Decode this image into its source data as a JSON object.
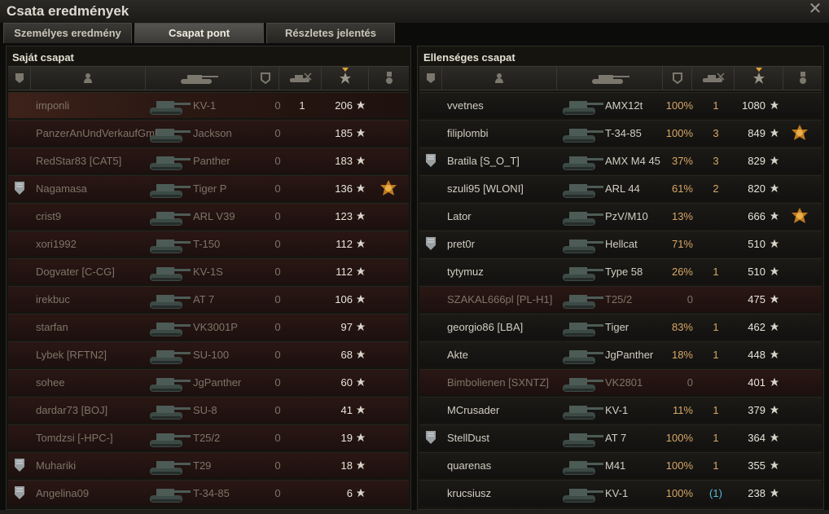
{
  "window": {
    "title": "Csata eredmények"
  },
  "tabs": [
    {
      "label": "Személyes eredmény",
      "active": false
    },
    {
      "label": "Csapat pont",
      "active": true
    },
    {
      "label": "Részletes jelentés",
      "active": false
    }
  ],
  "icons": {
    "close": "close-icon",
    "rank": "rank-shield-icon",
    "player": "player-silhouette-icon",
    "tank": "tank-icon",
    "damage": "shield-icon",
    "kills": "destroyed-tank-icon",
    "points": "star-icon",
    "medal": "medal-icon"
  },
  "colors": {
    "accent": "#e0a23a",
    "dead_row": "#2a1714",
    "enemy_percent": "#d8a766",
    "bracket_kill": "#5cb8d8"
  },
  "own_team": {
    "title": "Saját csapat",
    "rows": [
      {
        "name": "imponli",
        "tank": "KV-1",
        "frags": "0",
        "kills": "1",
        "points": "206",
        "dead": true,
        "rank": false,
        "medal": false
      },
      {
        "name": "PanzerAnUndVerkaufGmb",
        "tank": "Jackson",
        "frags": "0",
        "kills": "",
        "points": "185",
        "dead": true,
        "rank": false,
        "medal": false
      },
      {
        "name": "RedStar83 [CAT5]",
        "tank": "Panther",
        "frags": "0",
        "kills": "",
        "points": "183",
        "dead": true,
        "rank": false,
        "medal": false
      },
      {
        "name": "Nagamasa",
        "tank": "Tiger P",
        "frags": "0",
        "kills": "",
        "points": "136",
        "dead": true,
        "rank": true,
        "medal": true
      },
      {
        "name": "crist9",
        "tank": "ARL V39",
        "frags": "0",
        "kills": "",
        "points": "123",
        "dead": true,
        "rank": false,
        "medal": false
      },
      {
        "name": "xori1992",
        "tank": "T-150",
        "frags": "0",
        "kills": "",
        "points": "112",
        "dead": true,
        "rank": false,
        "medal": false
      },
      {
        "name": "Dogvater [C-CG]",
        "tank": "KV-1S",
        "frags": "0",
        "kills": "",
        "points": "112",
        "dead": true,
        "rank": false,
        "medal": false
      },
      {
        "name": "irekbuc",
        "tank": "AT 7",
        "frags": "0",
        "kills": "",
        "points": "106",
        "dead": true,
        "rank": false,
        "medal": false
      },
      {
        "name": "starfan",
        "tank": "VK3001P",
        "frags": "0",
        "kills": "",
        "points": "97",
        "dead": true,
        "rank": false,
        "medal": false
      },
      {
        "name": "Lybek [RFTN2]",
        "tank": "SU-100",
        "frags": "0",
        "kills": "",
        "points": "68",
        "dead": true,
        "rank": false,
        "medal": false
      },
      {
        "name": "sohee",
        "tank": "JgPanther",
        "frags": "0",
        "kills": "",
        "points": "60",
        "dead": true,
        "rank": false,
        "medal": false
      },
      {
        "name": "dardar73 [BOJ]",
        "tank": "SU-8",
        "frags": "0",
        "kills": "",
        "points": "41",
        "dead": true,
        "rank": false,
        "medal": false
      },
      {
        "name": "Tomdzsi [-HPC-]",
        "tank": "T25/2",
        "frags": "0",
        "kills": "",
        "points": "19",
        "dead": true,
        "rank": false,
        "medal": false
      },
      {
        "name": "Muhariki",
        "tank": "T29",
        "frags": "0",
        "kills": "",
        "points": "18",
        "dead": true,
        "rank": true,
        "medal": false
      },
      {
        "name": "Angelina09",
        "tank": "T-34-85",
        "frags": "0",
        "kills": "",
        "points": "6",
        "dead": true,
        "rank": true,
        "medal": false
      }
    ]
  },
  "enemy_team": {
    "title": "Ellenséges csapat",
    "rows": [
      {
        "name": "vvetnes",
        "tank": "AMX12t",
        "pct": "100%",
        "kills": "1",
        "bracket": false,
        "points": "1080",
        "dead": false,
        "rank": false,
        "medal": false
      },
      {
        "name": "filiplombi",
        "tank": "T-34-85",
        "pct": "100%",
        "kills": "3",
        "bracket": false,
        "points": "849",
        "dead": false,
        "rank": false,
        "medal": true
      },
      {
        "name": "Bratila [S_O_T]",
        "tank": "AMX M4 45",
        "pct": "37%",
        "kills": "3",
        "bracket": false,
        "points": "829",
        "dead": false,
        "rank": true,
        "medal": false
      },
      {
        "name": "szuli95 [WLONI]",
        "tank": "ARL 44",
        "pct": "61%",
        "kills": "2",
        "bracket": false,
        "points": "820",
        "dead": false,
        "rank": false,
        "medal": false
      },
      {
        "name": "Lator",
        "tank": "PzV/M10",
        "pct": "13%",
        "kills": "",
        "bracket": false,
        "points": "666",
        "dead": false,
        "rank": false,
        "medal": true
      },
      {
        "name": "pret0r",
        "tank": "Hellcat",
        "pct": "71%",
        "kills": "",
        "bracket": false,
        "points": "510",
        "dead": false,
        "rank": true,
        "medal": false
      },
      {
        "name": "tytymuz",
        "tank": "Type 58",
        "pct": "26%",
        "kills": "1",
        "bracket": false,
        "points": "510",
        "dead": false,
        "rank": false,
        "medal": false
      },
      {
        "name": "SZAKAL666pl [PL-H1]",
        "tank": "T25/2",
        "pct": "0",
        "kills": "",
        "bracket": false,
        "points": "475",
        "dead": true,
        "rank": false,
        "medal": false
      },
      {
        "name": "georgio86 [LBA]",
        "tank": "Tiger",
        "pct": "83%",
        "kills": "1",
        "bracket": false,
        "points": "462",
        "dead": false,
        "rank": false,
        "medal": false
      },
      {
        "name": "Akte",
        "tank": "JgPanther",
        "pct": "18%",
        "kills": "1",
        "bracket": false,
        "points": "448",
        "dead": false,
        "rank": false,
        "medal": false
      },
      {
        "name": "Bimbolienen [SXNTZ]",
        "tank": "VK2801",
        "pct": "0",
        "kills": "",
        "bracket": false,
        "points": "401",
        "dead": true,
        "rank": false,
        "medal": false
      },
      {
        "name": "MCrusader",
        "tank": "KV-1",
        "pct": "11%",
        "kills": "1",
        "bracket": false,
        "points": "379",
        "dead": false,
        "rank": false,
        "medal": false
      },
      {
        "name": "StellDust",
        "tank": "AT 7",
        "pct": "100%",
        "kills": "1",
        "bracket": false,
        "points": "364",
        "dead": false,
        "rank": true,
        "medal": false
      },
      {
        "name": "quarenas",
        "tank": "M41",
        "pct": "100%",
        "kills": "1",
        "bracket": false,
        "points": "355",
        "dead": false,
        "rank": false,
        "medal": false
      },
      {
        "name": "krucsiusz",
        "tank": "KV-1",
        "pct": "100%",
        "kills": "(1)",
        "bracket": true,
        "points": "238",
        "dead": false,
        "rank": false,
        "medal": false
      }
    ]
  }
}
